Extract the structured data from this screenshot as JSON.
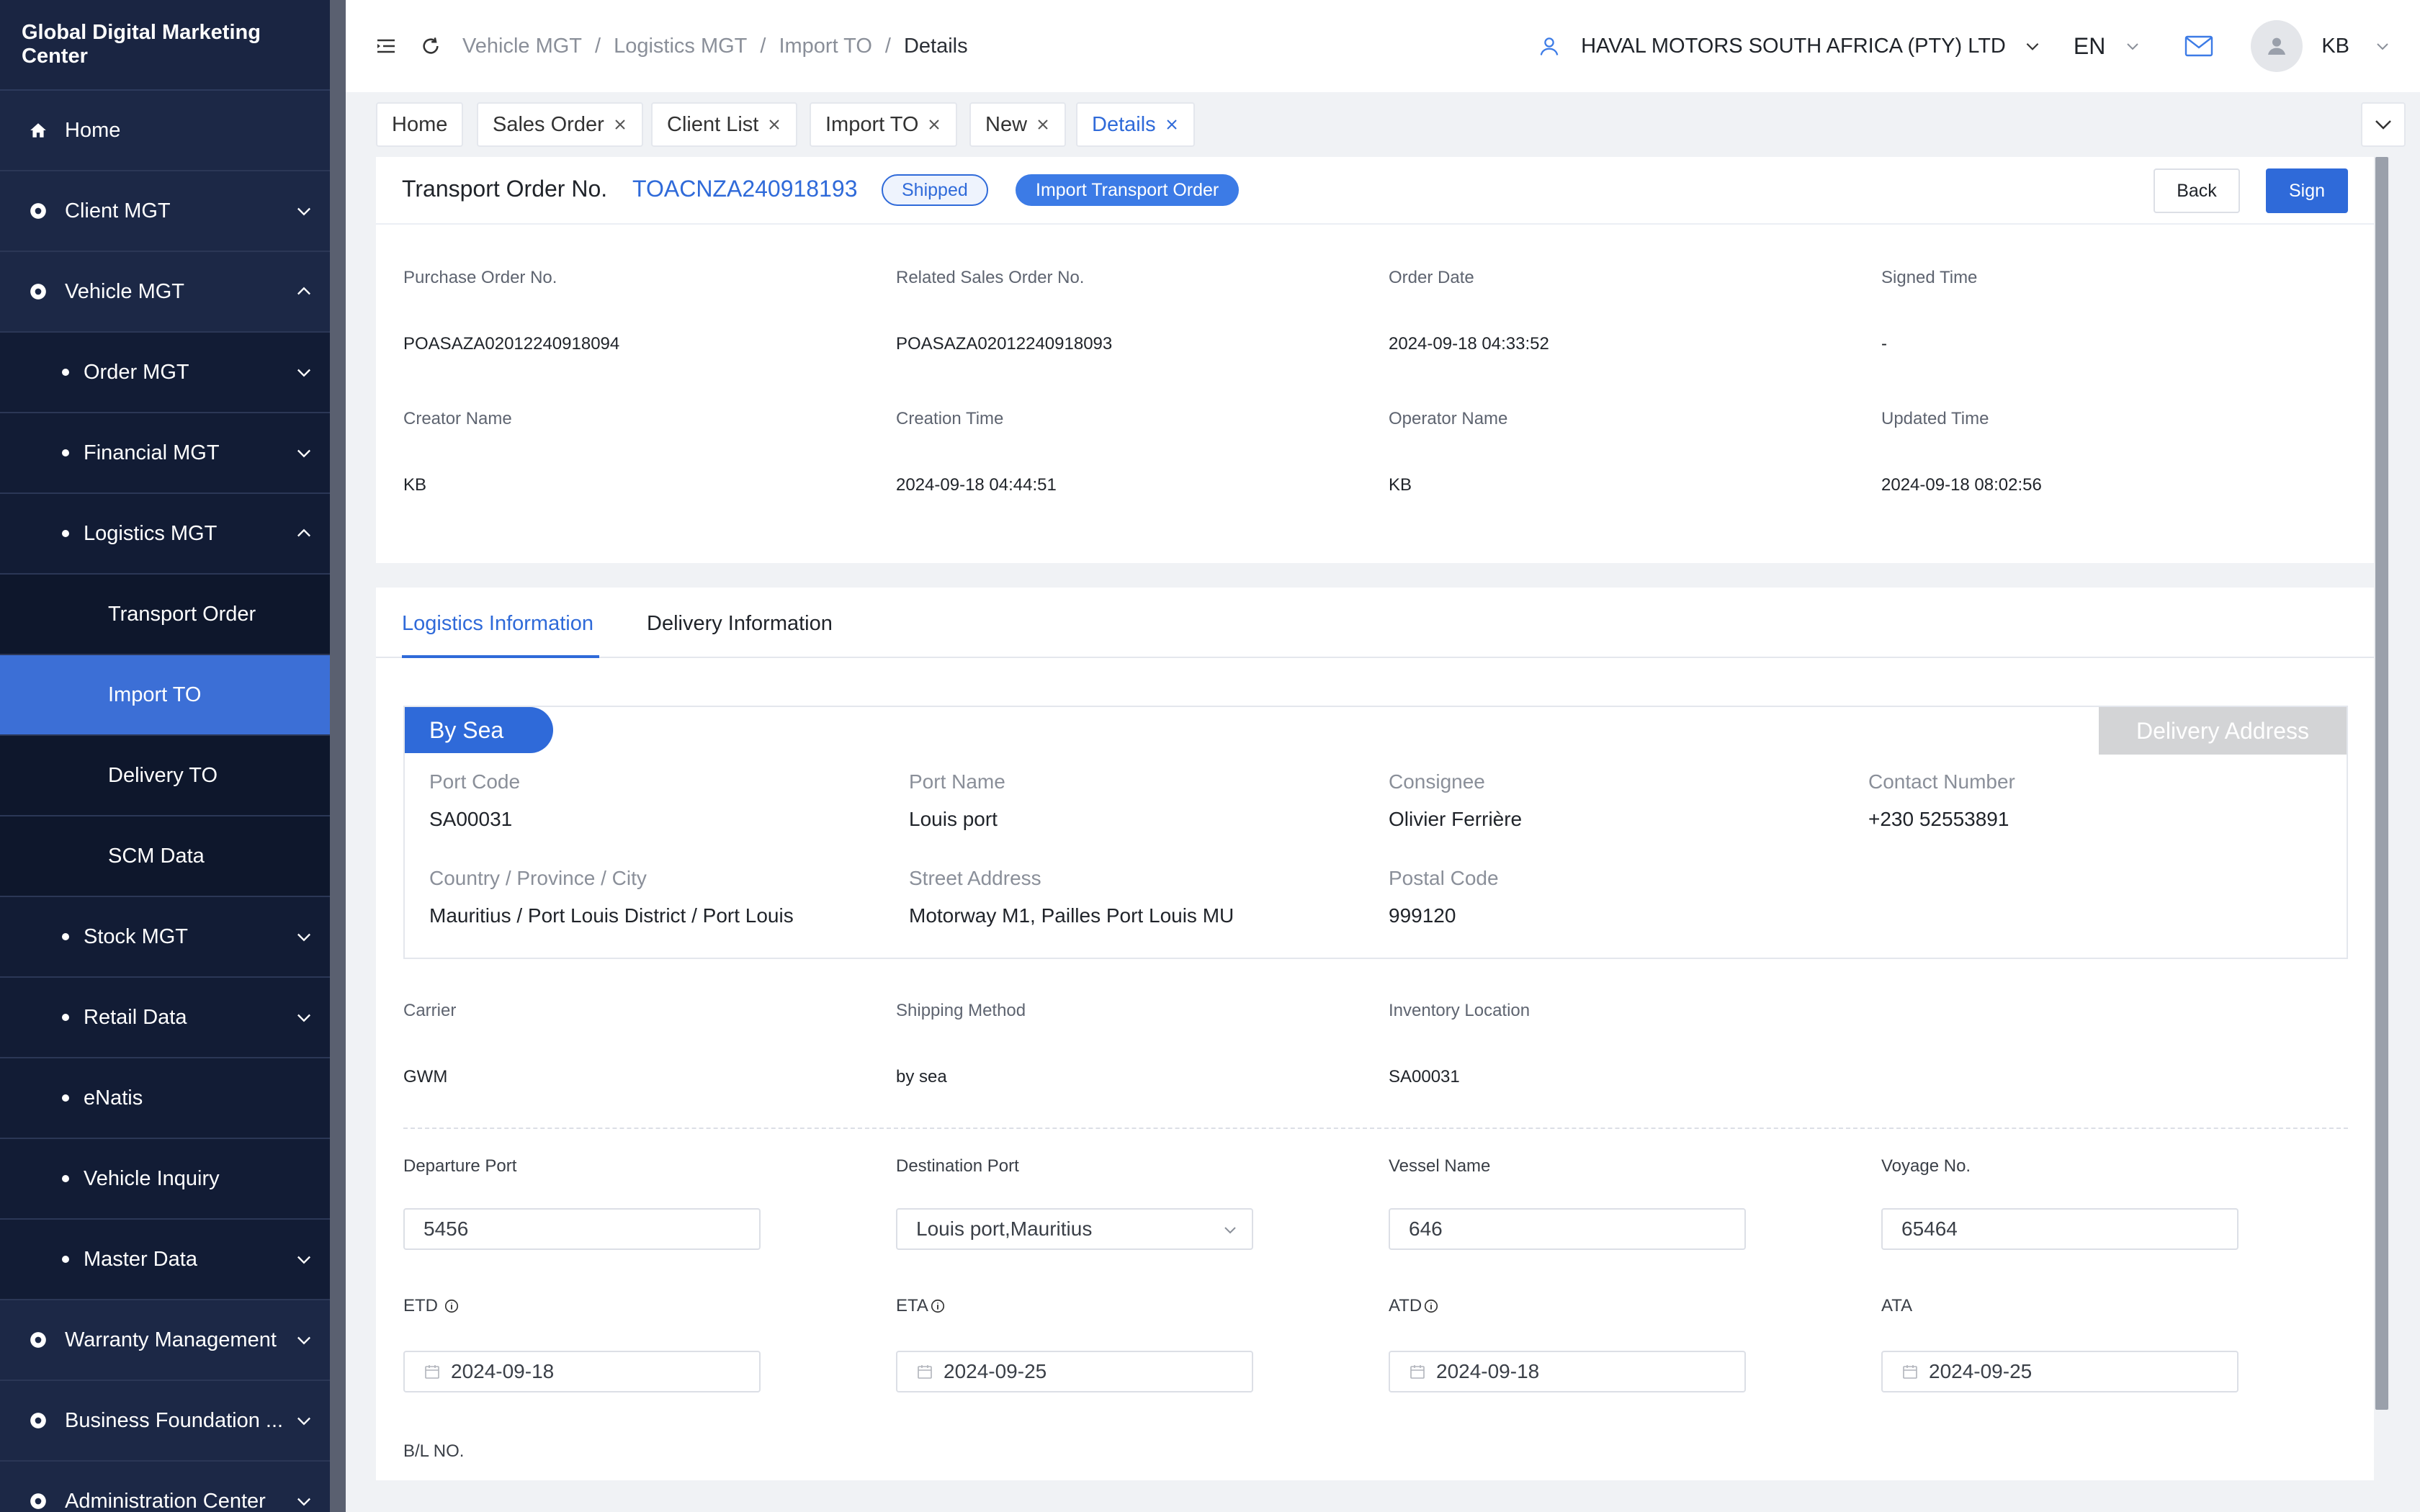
{
  "app_title": "Global Digital Marketing Center",
  "sidebar": {
    "items": [
      {
        "label": "Home",
        "icon": "home-icon"
      },
      {
        "label": "Client MGT",
        "icon": "gear-icon"
      },
      {
        "label": "Vehicle MGT",
        "icon": "gear-icon"
      },
      {
        "label": "Order MGT"
      },
      {
        "label": "Financial MGT"
      },
      {
        "label": "Logistics MGT"
      },
      {
        "label": "Transport Order"
      },
      {
        "label": "Import TO"
      },
      {
        "label": "Delivery TO"
      },
      {
        "label": "SCM Data"
      },
      {
        "label": "Stock MGT"
      },
      {
        "label": "Retail Data"
      },
      {
        "label": "eNatis"
      },
      {
        "label": "Vehicle Inquiry"
      },
      {
        "label": "Master Data"
      },
      {
        "label": "Warranty Management",
        "icon": "gear-icon"
      },
      {
        "label": "Business Foundation ...",
        "icon": "gear-icon"
      },
      {
        "label": "Administration Center",
        "icon": "gear-icon"
      }
    ]
  },
  "topbar": {
    "breadcrumb": [
      "Vehicle MGT",
      "Logistics MGT",
      "Import TO",
      "Details"
    ],
    "separator": "/",
    "company": "HAVAL MOTORS SOUTH AFRICA (PTY) LTD",
    "language": "EN",
    "user": "KB"
  },
  "tabs": [
    {
      "label": "Home"
    },
    {
      "label": "Sales Order"
    },
    {
      "label": "Client List"
    },
    {
      "label": "Import TO"
    },
    {
      "label": "New"
    },
    {
      "label": "Details"
    }
  ],
  "header": {
    "label": "Transport Order No.",
    "number": "TOACNZA240918193",
    "status": "Shipped",
    "type_badge": "Import Transport Order",
    "back_label": "Back",
    "sign_label": "Sign"
  },
  "info": [
    {
      "label": "Purchase Order No.",
      "value": "POASAZA02012240918094"
    },
    {
      "label": "Related Sales Order No.",
      "value": "POASAZA02012240918093"
    },
    {
      "label": "Order Date",
      "value": "2024-09-18 04:33:52"
    },
    {
      "label": "Signed Time",
      "value": "-"
    },
    {
      "label": "Creator Name",
      "value": "KB"
    },
    {
      "label": "Creation Time",
      "value": "2024-09-18 04:44:51"
    },
    {
      "label": "Operator Name",
      "value": "KB"
    },
    {
      "label": "Updated Time",
      "value": "2024-09-18 08:02:56"
    }
  ],
  "logistics_tabs": [
    "Logistics Information",
    "Delivery Information"
  ],
  "sea": {
    "tag": "By Sea",
    "delivery_address_label": "Delivery Address",
    "fields": [
      {
        "label": "Port Code",
        "value": "SA00031"
      },
      {
        "label": "Port Name",
        "value": "Louis port"
      },
      {
        "label": "Consignee",
        "value": "Olivier Ferrière"
      },
      {
        "label": "Contact Number",
        "value": "+230 52553891"
      },
      {
        "label": "Country / Province / City",
        "value": "Mauritius / Port Louis District / Port Louis"
      },
      {
        "label": "Street Address",
        "value": "Motorway M1, Pailles Port Louis MU"
      },
      {
        "label": "Postal Code",
        "value": "999120"
      }
    ]
  },
  "carrier_row": [
    {
      "label": "Carrier",
      "value": "GWM"
    },
    {
      "label": "Shipping Method",
      "value": "by sea"
    },
    {
      "label": "Inventory Location",
      "value": "SA00031"
    }
  ],
  "form": {
    "departure_port": {
      "label": "Departure Port",
      "value": "5456"
    },
    "destination_port": {
      "label": "Destination Port",
      "value": "Louis port,Mauritius"
    },
    "vessel_name": {
      "label": "Vessel Name",
      "value": "646"
    },
    "voyage_no": {
      "label": "Voyage No.",
      "value": "65464"
    },
    "etd": {
      "label": "ETD",
      "value": "2024-09-18"
    },
    "eta": {
      "label": "ETA",
      "value": "2024-09-25"
    },
    "atd": {
      "label": "ATD",
      "value": "2024-09-18"
    },
    "ata": {
      "label": "ATA",
      "value": "2024-09-25"
    },
    "bl_no": {
      "label": "B/L NO."
    }
  }
}
